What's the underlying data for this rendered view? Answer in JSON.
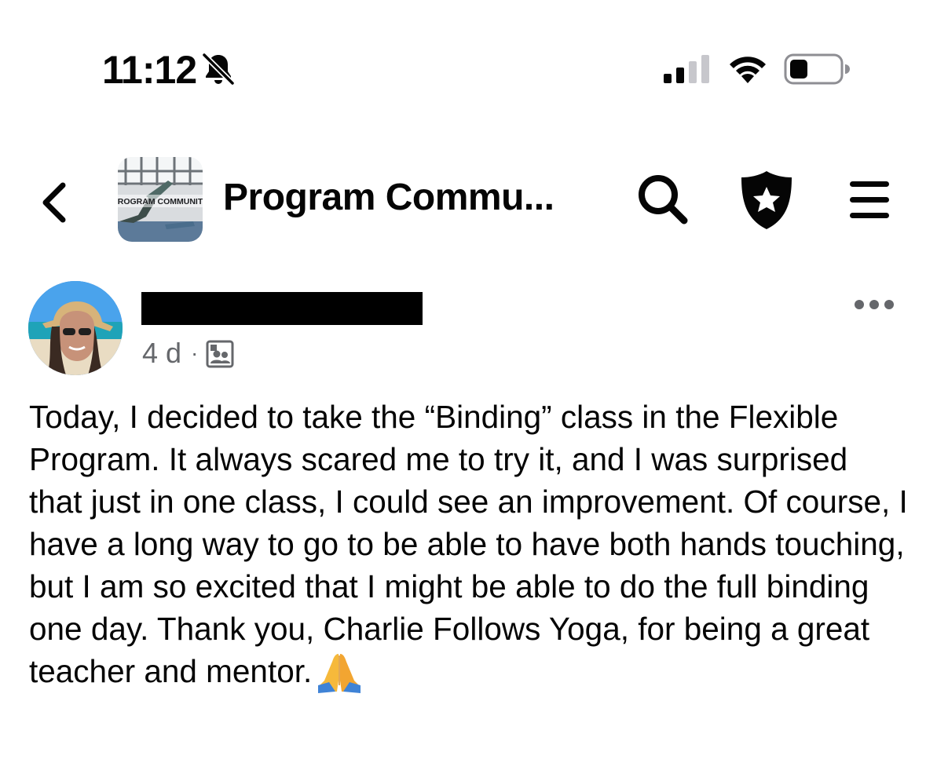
{
  "status_bar": {
    "time": "11:12",
    "icons": [
      "bell-slash-icon",
      "cellular-signal-icon",
      "wifi-icon",
      "battery-icon"
    ]
  },
  "header": {
    "back_icon": "chevron-left-icon",
    "group_thumbnail_text": "PROGRAM COMMUNITY",
    "title": "Program Commu...",
    "actions": [
      "search-icon",
      "shield-star-icon",
      "hamburger-menu-icon"
    ]
  },
  "post": {
    "author_name": "",
    "time": "4 d",
    "separator": "·",
    "audience_icon": "group-members-icon",
    "more_icon": "more-horizontal-icon",
    "body": "Today, I decided to take the “Binding” class in the Flexible Program. It always scared me to try it, and I was surprised that just in one class, I could see an improvement. Of course, I have a long way to go to be able to have both hands touching, but I am so excited that I might be able to do the full binding one day. Thank you, Charlie Follows Yoga, for being a great teacher and mentor.",
    "emoji": "folded-hands-emoji"
  },
  "colors": {
    "text": "#050505",
    "secondary_text": "#65676b",
    "redaction": "#000000"
  }
}
